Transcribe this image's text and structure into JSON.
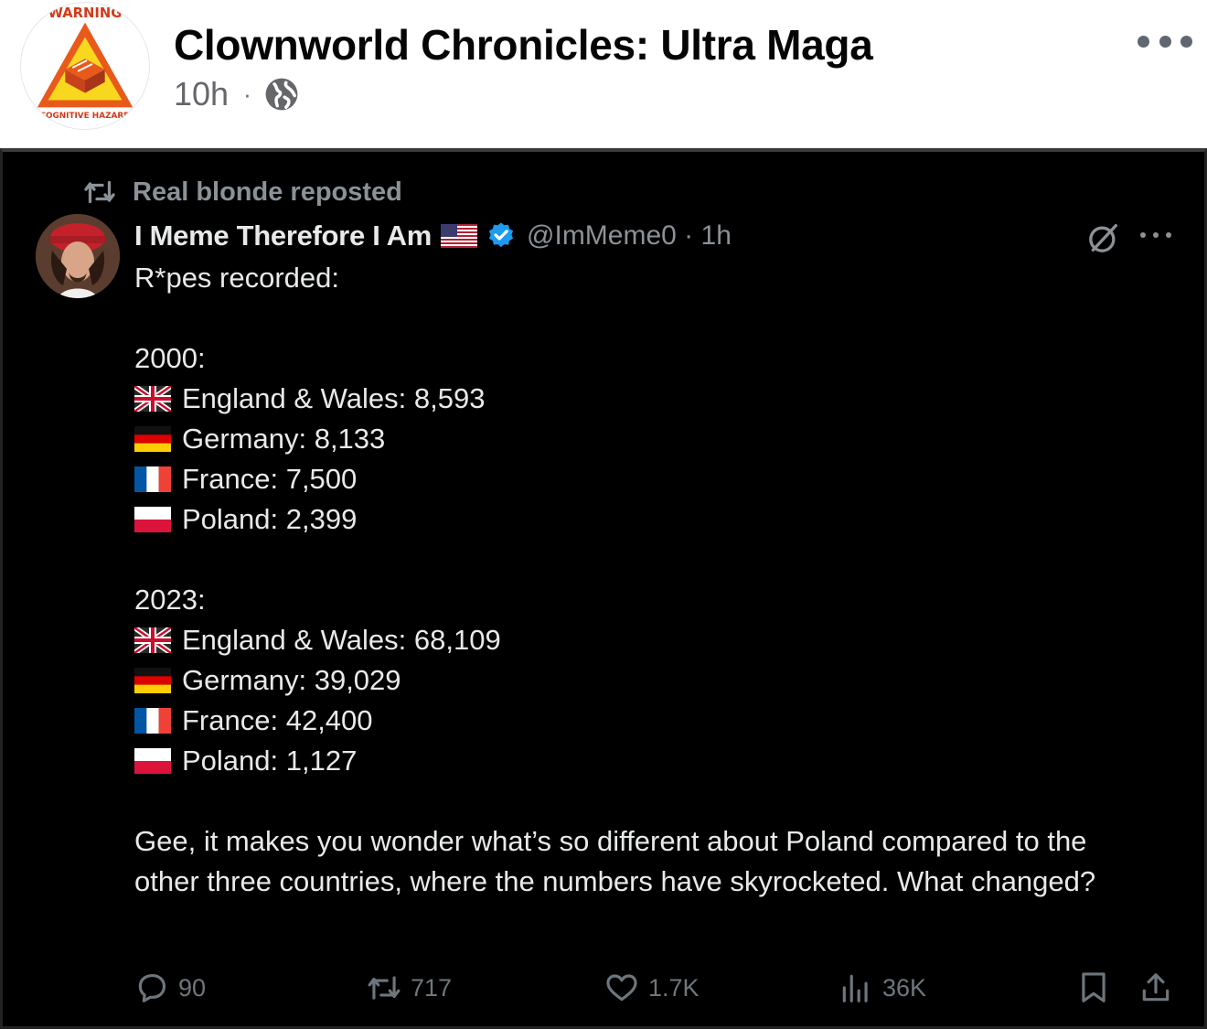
{
  "post": {
    "page_name": "Clownworld Chronicles: Ultra Maga",
    "time": "10h",
    "separator": "·",
    "avatar_text_top": "WARNING",
    "avatar_text_bottom": "COGNITIVE HAZARD",
    "privacy_icon": "globe-icon",
    "more_icon": "more-horizontal-icon"
  },
  "tweet": {
    "repost_label": "Real blonde reposted",
    "author_name": "I Meme Therefore I Am",
    "handle": "@ImMeme0 · 1h",
    "intro": "R*pes recorded:",
    "sections": [
      {
        "year": "2000:",
        "rows": [
          {
            "flag": "uk",
            "text": "England & Wales: 8,593"
          },
          {
            "flag": "de",
            "text": "Germany: 8,133"
          },
          {
            "flag": "fr",
            "text": "France: 7,500"
          },
          {
            "flag": "pl",
            "text": "Poland: 2,399"
          }
        ]
      },
      {
        "year": "2023:",
        "rows": [
          {
            "flag": "uk",
            "text": "England & Wales: 68,109"
          },
          {
            "flag": "de",
            "text": "Germany: 39,029"
          },
          {
            "flag": "fr",
            "text": "France: 42,400"
          },
          {
            "flag": "pl",
            "text": "Poland: 1,127"
          }
        ]
      }
    ],
    "closing": "Gee, it makes you wonder what’s so different about Poland compared to the other three countries, where the numbers have skyrocketed. What changed?",
    "actions": {
      "replies": "90",
      "reposts": "717",
      "likes": "1.7K",
      "views": "36K"
    }
  },
  "colors": {
    "tweet_bg": "#000000",
    "tweet_text": "#e7e9ea",
    "tweet_muted": "#8b9197",
    "verified_blue": "#1d9bf0",
    "fb_title": "#050505",
    "fb_muted": "#65676b"
  }
}
